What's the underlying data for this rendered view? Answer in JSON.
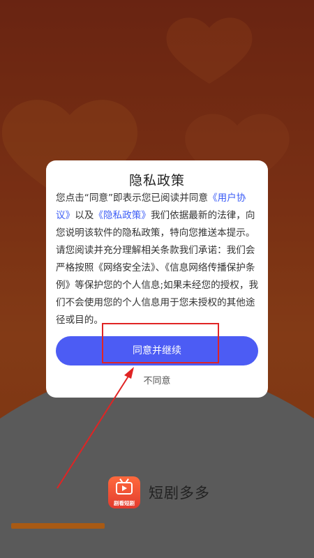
{
  "dialog": {
    "title": "隐私政策",
    "body_parts": [
      "您点击“同意”即表示您已阅读并同意",
      "《用户协议》",
      "以及",
      "《隐私政策》",
      "我们依据最新的法律，向您说明该软件的隐私政策，特向您推送本提示。请您阅读并充分理解相关条款我们承诺：我们会严格按照《网络安全法》、《信息网络传播保护条例》等保护您的个人信息;如果未经您的授权，我们不会使用您的个人信息用于您未授权的其他途径或目的。"
    ],
    "agree_label": "同意并继续",
    "disagree_label": "不同意"
  },
  "brand": {
    "app_name": "短剧多多",
    "icon_caption": "剧看短剧",
    "icon": "tv-play-icon"
  },
  "loading": {
    "progress": 0.3
  },
  "annotation": {
    "color": "#e02424"
  },
  "colors": {
    "accent": "#4c5cf4",
    "link": "#3b5cf6",
    "background_top": "#c45620",
    "background_bottom": "#7b7b7b"
  }
}
